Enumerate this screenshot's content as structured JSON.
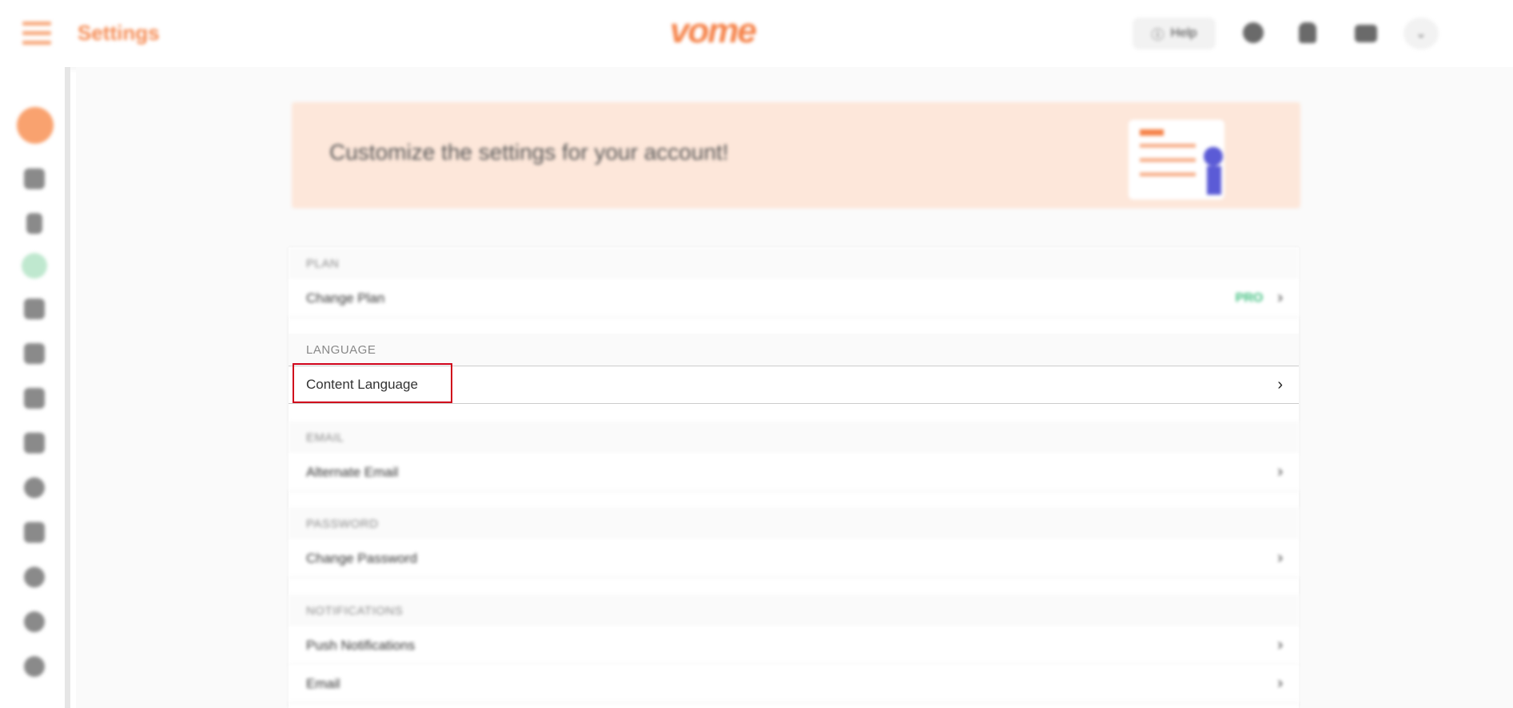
{
  "header": {
    "title": "Settings",
    "logo_text": "vome",
    "help_label": "Help",
    "icons": [
      "menu-icon",
      "globe-icon",
      "bell-icon",
      "chat-icon",
      "chevron-down-icon"
    ]
  },
  "sidebar": {
    "icons": [
      "avatar",
      "inbox-icon",
      "bell-icon",
      "status-icon",
      "bar-chart-icon",
      "trend-icon",
      "calendar-icon",
      "list-icon",
      "globe-icon",
      "people-icon",
      "gear-icon",
      "shield-icon",
      "settings-icon"
    ]
  },
  "banner": {
    "text": "Customize the settings for your account!"
  },
  "sections": {
    "plan": {
      "heading": "PLAN",
      "item": "Change Plan",
      "badge": "PRO"
    },
    "language": {
      "heading": "LANGUAGE",
      "item": "Content Language"
    },
    "email": {
      "heading": "EMAIL",
      "item": "Alternate Email"
    },
    "password": {
      "heading": "PASSWORD",
      "item": "Change Password"
    },
    "notifications": {
      "heading": "NOTIFICATIONS",
      "items": [
        "Push Notifications",
        "Email"
      ]
    }
  },
  "colors": {
    "brand": "#f5834a",
    "banner_bg": "#fde7da",
    "pro_badge": "#3fbf7f",
    "highlight": "#d0021b"
  }
}
